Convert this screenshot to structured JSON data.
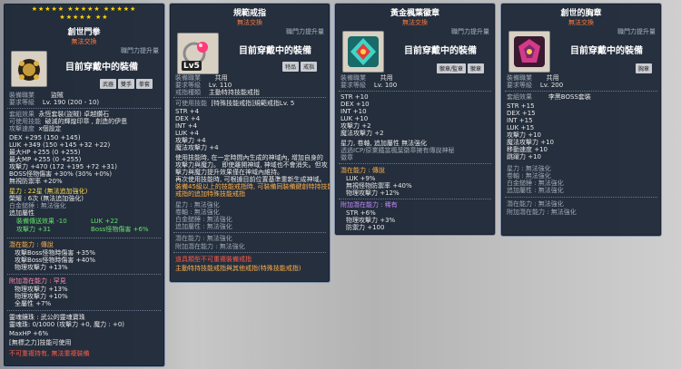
{
  "panel1": {
    "stars_top": "★★★★★ ★★★★★ ★★★★★",
    "stars_bottom": "★★★★★ ★★",
    "title": "創世門拳",
    "tradeable": "無法交換",
    "upgrade_hint": "職門力提升量",
    "equipped": "目前穿戴中的裝備",
    "tags": [
      "武器",
      "雙手",
      "拳套"
    ],
    "job_label": "裝備職業",
    "job_value": "盜賊",
    "req_label": "要求等級",
    "req_value": "Lv. 190 (200 - 10)",
    "set_effect": "套組效果",
    "set_effect_items": [
      "永恆套裝(盜賊) 卓越鑽石",
      "破滅的輝煌印章 , 創造的伊恩",
      "x個設定"
    ],
    "attack_type": "攻擊速度",
    "lines": [
      "DEX +295 (150 +145)",
      "LUK +349 (150 +145 +32 +22)",
      "最大HP +255 (0 +255)",
      "最大MP +255 (0 +255)",
      "攻擊力 +470 (172 +195 +72 +31)",
      "BOSS怪物傷害 +30% (30% +0%)",
      "無視防禦率 +20%"
    ],
    "star_force": "星力 : 22星 (無法追加強化)",
    "soul": "榮耀 : 6次 (無法追加強化)",
    "white_soul": "白金鎚錘 : 無法強化",
    "extra_attr": "追加屬性",
    "extra_sub": [
      "裝備傳送效果 -10",
      "LUK +22"
    ],
    "extra_sub2": [
      "攻擊力 +31",
      "Boss怪物傷害 +6%"
    ],
    "potential_head": "潛在能力 : 傳說",
    "potential": [
      "攻擊Boss怪物時傷害 +35%",
      "攻擊Boss怪物時傷害 +40%",
      "物理攻擊力 +13%"
    ],
    "add_pot_head": "附加潛在能力 : 罕見",
    "add_pot": [
      "物理攻擊力 +13%",
      "物理攻擊力 +10%",
      "全屬性 +7%"
    ],
    "soul_weapon": "靈魂鑲珠 : 武公的靈魂寶珠",
    "soul_detail": "靈魂珠: 0/1000 (攻擊力 +0, 魔力 : +0)",
    "max_hp": "MaxHP +6%",
    "soul_skill": "[無標之力]技能可使用",
    "unequip": "不可重複持有, 無法重複裝備"
  },
  "panel2": {
    "title": "規範戒指",
    "tradeable": "無法交換",
    "upgrade_hint": "職門力提升量",
    "equipped": "目前穿戴中的裝備",
    "tags": [
      "特品",
      "戒指"
    ],
    "icon_badge": "Lv5",
    "job_label": "裝備職業",
    "job_value": "共用",
    "req_label": "要求等級",
    "req_value": "Lv. 110",
    "type_label": "戒指種類",
    "type_value": "主動特持技能戒指",
    "skill_label": "可使用技能",
    "skill_value": "[特殊技能戒指]規範戒指Lv. 5",
    "stats": [
      "STR +4",
      "DEX +4",
      "INT +4",
      "LUK +4",
      "攻擊力 +4",
      "魔法攻擊力 +4"
    ],
    "desc": [
      "使用技能時, 在一定時間內生成的神域內, 增加自身的",
      "攻擊力與魔力。 即使離開神域, 神域也不會消失。但攻",
      "擊力與魔力提升效果僅在神域內維持。",
      "再次使用技能時, 可根據目前位置基準重新生成神域。",
      "裝備45級以上的技能戒指時, 可裝備同裝備鍵創特持技能",
      "戒指的追加特殊技能戒指"
    ],
    "star_force": "星力 : 無法強化",
    "soul": "卷軸 : 無法強化",
    "white_soul": "白金鎚錘 : 無法強化",
    "extra_attr": "追加屬性 : 無法強化",
    "potential_head": "潛在能力 : 無法強化",
    "add_pot_head": "附加潛在能力 : 無法強化",
    "warn1": "道具類型不可重複裝備戒指",
    "warn2": "主動特持技能戒指與其他戒指(特殊技能戒指)"
  },
  "panel3": {
    "title": "黃金楓葉徽章",
    "tradeable": "無法交換",
    "upgrade_hint": "職門力提升量",
    "equipped": "目前穿戴中的裝備",
    "tags": [
      "徽章/監章",
      "徽章"
    ],
    "job_label": "裝備職業",
    "job_value": "共用",
    "req_label": "要求等級",
    "req_value": "Lv. 100",
    "stats": [
      "STR +10",
      "DEX +10",
      "INT +10",
      "LUK +10",
      "攻擊力 +2",
      "魔法攻擊力 +2"
    ],
    "star_force": "星力, 卷軸, 追加屬性 無法強化",
    "desc": [
      "透過ICP/原業鐵當楓葉徽章擁有傳說神秘",
      "徽章"
    ],
    "potential_head": "潛在能力 : 傳說",
    "potential": [
      "LUK +9%",
      "無視怪物防禦率 +40%",
      "物理攻擊力 +12%"
    ],
    "add_pot_head": "附加潛在能力 : 稀有",
    "add_pot": [
      "STR +6%",
      "物理攻擊力 +3%",
      "防禦力 +100"
    ]
  },
  "panel4": {
    "title": "創世的胸章",
    "tradeable": "無法交換",
    "upgrade_hint": "職門力提升量",
    "equipped": "目前穿戴中的裝備",
    "tags": [
      "胸章"
    ],
    "job_label": "裝備職業",
    "job_value": "共用",
    "req_label": "要求等級",
    "req_value": "Lv. 200",
    "set_effect": "套組效果",
    "set_value": "李黑BOSS套裝",
    "stats": [
      "STR +15",
      "DEX +15",
      "INT +15",
      "LUK +15",
      "攻擊力 +10",
      "魔法攻擊力 +10",
      "移動速度 +10",
      "跳躍力 +10"
    ],
    "star_force": "星力 : 無法強化",
    "soul": "卷軸 : 無法強化",
    "white_soul": "白金鎚錘 : 無法強化",
    "extra_attr": "追加屬性 : 無法強化",
    "potential_head": "潛在能力 : 無法強化",
    "add_pot_head": "附加潛在能力 : 無法強化"
  },
  "colors": {
    "panel_bg": "#1c2736",
    "accent_orange": "#ff7a3c",
    "star_yellow": "#ffd400",
    "legend_green": "#64e06e"
  }
}
